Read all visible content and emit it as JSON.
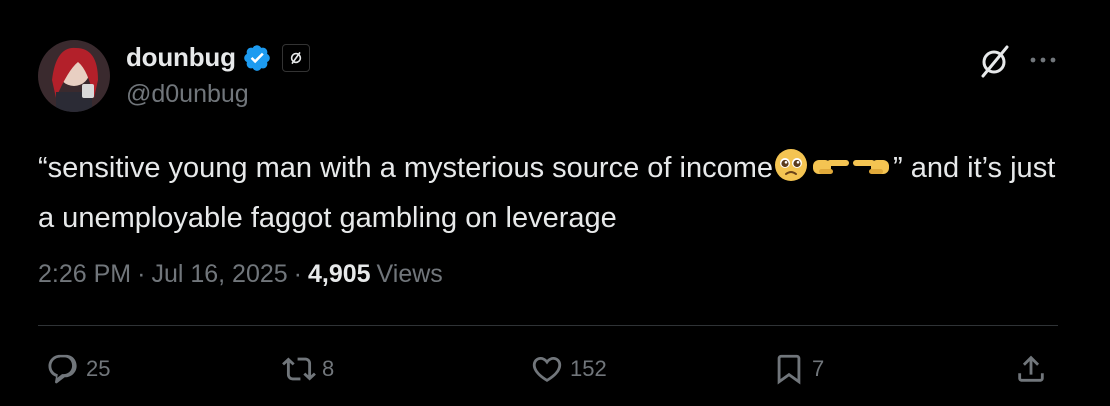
{
  "author": {
    "display_name": "dounbug",
    "handle": "@d0unbug",
    "verified": true,
    "icons": [
      "verified-badge-icon",
      "affiliate-badge-icon",
      "grok-icon",
      "more-icon"
    ]
  },
  "tweet": {
    "text_part1": "“sensitive young man with a mysterious source of income",
    "text_part2": "” and it’s just a unemployable faggot gambling on leverage",
    "emojis": [
      "pleading-face-emoji",
      "pointing-right-emoji",
      "pointing-left-emoji"
    ]
  },
  "meta": {
    "time": "2:26 PM",
    "sep1": "·",
    "date": "Jul 16, 2025",
    "sep2": "·",
    "views_count": "4,905",
    "views_label": "Views"
  },
  "actions": {
    "replies": "25",
    "reposts": "8",
    "likes": "152",
    "bookmarks": "7"
  },
  "colors": {
    "background": "#000000",
    "text": "#e7e9ea",
    "secondary": "#71767b",
    "verified": "#1d9bf0",
    "divider": "#2f3336"
  }
}
